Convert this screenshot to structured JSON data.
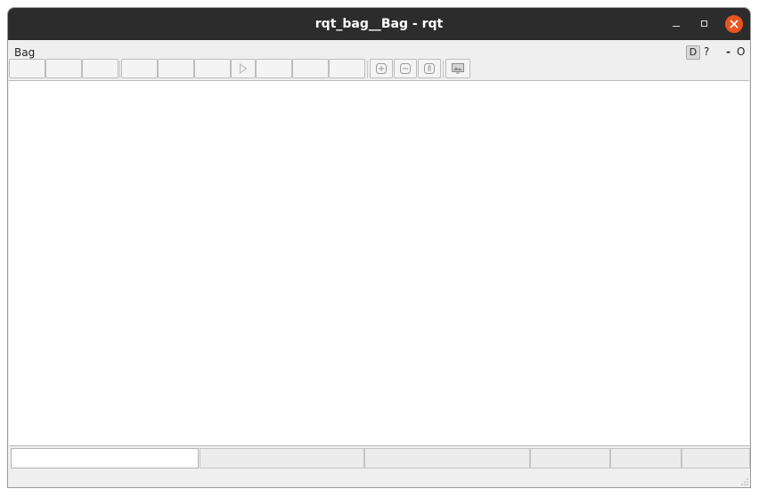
{
  "window": {
    "title": "rqt_bag__Bag - rqt"
  },
  "menubar": {
    "bag_label": "Bag",
    "dock_d_label": "D",
    "dock_help_label": "?",
    "dock_min_label": "-",
    "dock_close_label": "O"
  },
  "toolbar": {
    "buttons": [
      {
        "icon": "empty"
      },
      {
        "icon": "empty"
      },
      {
        "icon": "empty"
      },
      {
        "icon": "empty"
      },
      {
        "icon": "empty"
      },
      {
        "icon": "empty"
      },
      {
        "icon": "play-icon"
      },
      {
        "icon": "empty"
      },
      {
        "icon": "empty"
      },
      {
        "icon": "empty"
      },
      {
        "icon": "zoom-in-icon"
      },
      {
        "icon": "zoom-out-icon"
      },
      {
        "icon": "zoom-reset-icon"
      },
      {
        "icon": "thumbnails-icon"
      }
    ]
  },
  "status_fields": [
    {
      "value": ""
    },
    {
      "value": ""
    },
    {
      "value": ""
    },
    {
      "value": ""
    },
    {
      "value": ""
    },
    {
      "value": ""
    }
  ],
  "colors": {
    "titlebar": "#2c2c2c",
    "close_button": "#e95420",
    "background": "#efefef"
  }
}
